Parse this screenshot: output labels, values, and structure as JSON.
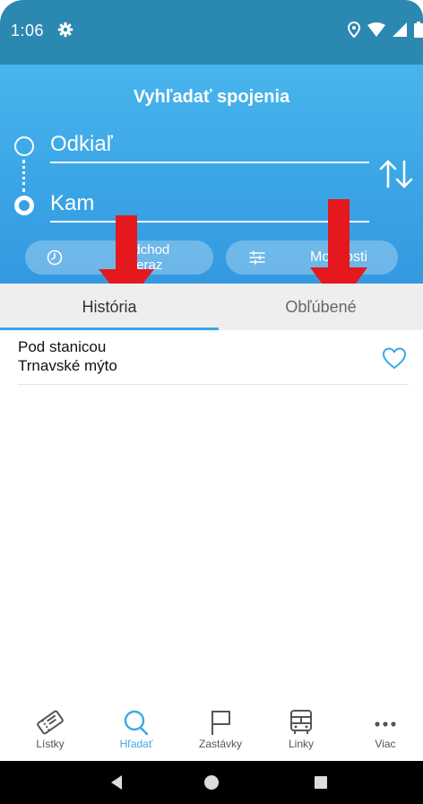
{
  "status_bar": {
    "time": "1:06"
  },
  "header": {
    "title": "Vyhľadať spojenia",
    "from_placeholder": "Odkiaľ",
    "to_placeholder": "Kam",
    "departure": {
      "label": "Odchod",
      "value": "Teraz"
    },
    "options_label": "Možnosti"
  },
  "tabs": [
    {
      "label": "História",
      "active": true
    },
    {
      "label": "Obľúbené",
      "active": false
    }
  ],
  "history": [
    {
      "from": "Pod stanicou",
      "to": "Trnavské mýto"
    }
  ],
  "bottom_nav": [
    {
      "label": "Lístky",
      "icon": "ticket-icon"
    },
    {
      "label": "Hľadať",
      "icon": "search-icon",
      "active": true
    },
    {
      "label": "Zastávky",
      "icon": "flag-icon"
    },
    {
      "label": "Linky",
      "icon": "bus-icon"
    },
    {
      "label": "Viac",
      "icon": "more-icon"
    }
  ],
  "colors": {
    "status_bar": "#2b88b0",
    "header": "#3aa5e6",
    "accent": "#3ba7e8",
    "annotation_arrow": "#e5191d"
  }
}
